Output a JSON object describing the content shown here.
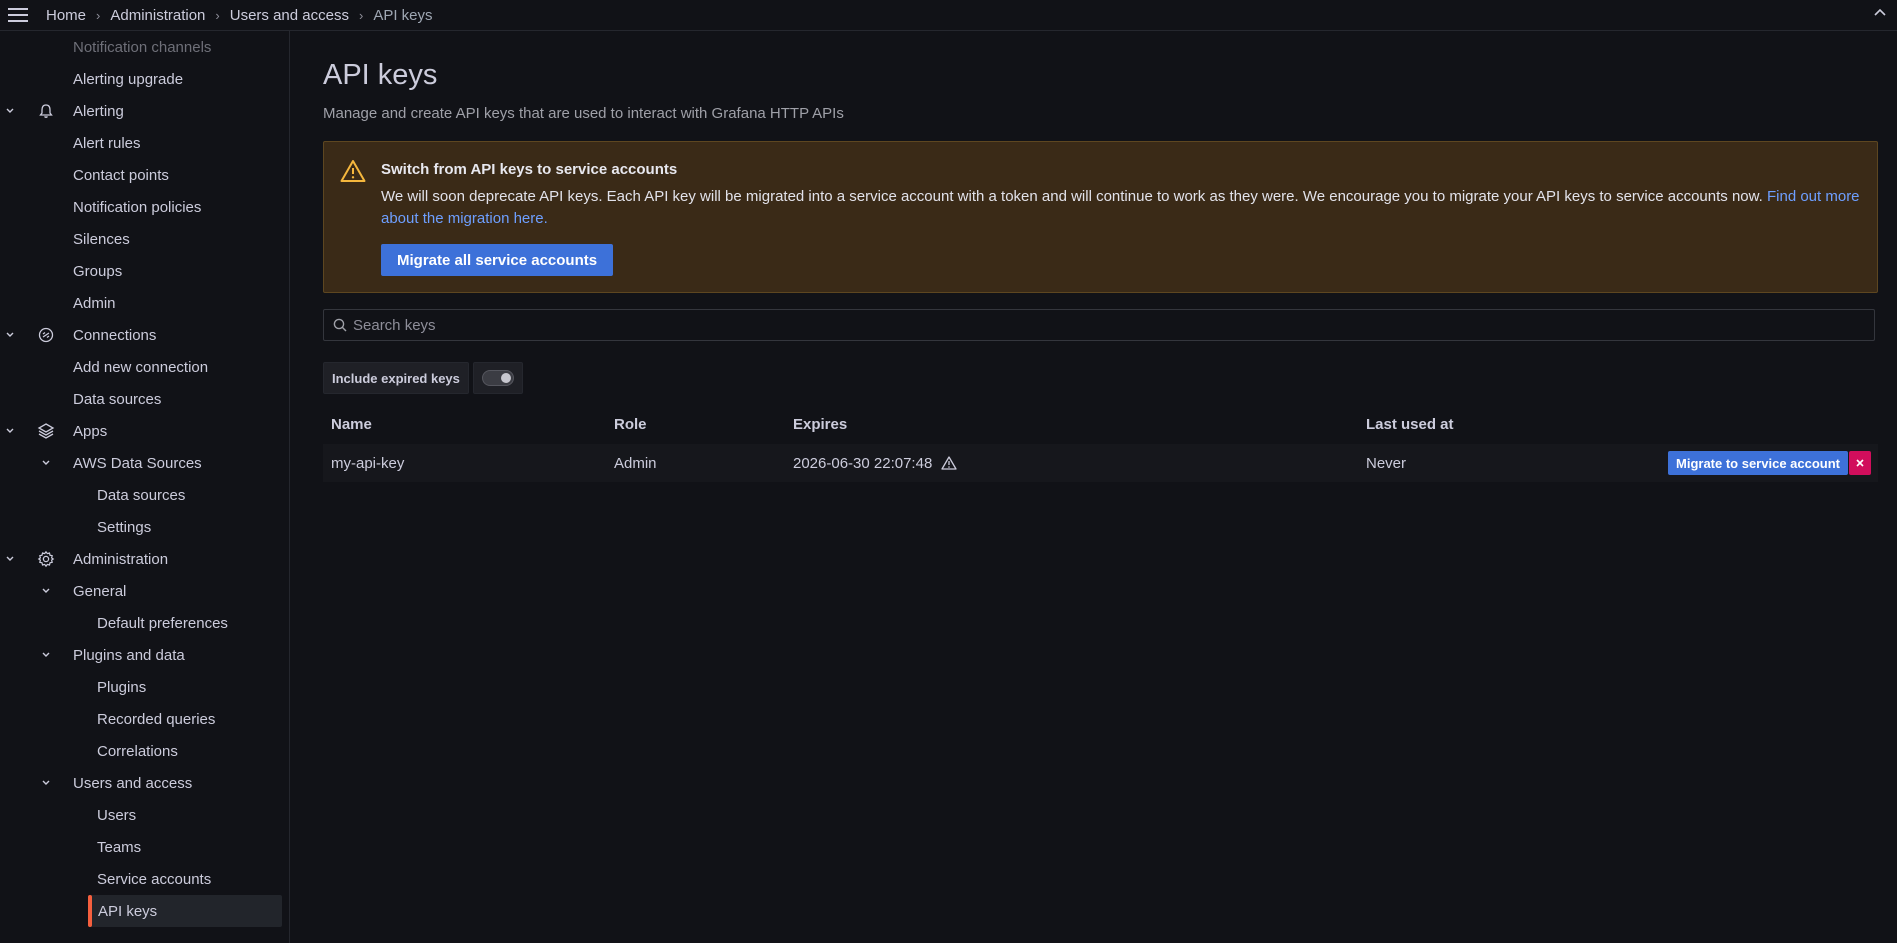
{
  "breadcrumb": {
    "items": [
      "Home",
      "Administration",
      "Users and access",
      "API keys"
    ]
  },
  "sidebar": {
    "items": [
      {
        "label": "Notification channels"
      },
      {
        "label": "Alerting upgrade"
      },
      {
        "label": "Alerting"
      },
      {
        "label": "Alert rules"
      },
      {
        "label": "Contact points"
      },
      {
        "label": "Notification policies"
      },
      {
        "label": "Silences"
      },
      {
        "label": "Groups"
      },
      {
        "label": "Admin"
      },
      {
        "label": "Connections"
      },
      {
        "label": "Add new connection"
      },
      {
        "label": "Data sources"
      },
      {
        "label": "Apps"
      },
      {
        "label": "AWS Data Sources"
      },
      {
        "label": "Data sources"
      },
      {
        "label": "Settings"
      },
      {
        "label": "Administration"
      },
      {
        "label": "General"
      },
      {
        "label": "Default preferences"
      },
      {
        "label": "Plugins and data"
      },
      {
        "label": "Plugins"
      },
      {
        "label": "Recorded queries"
      },
      {
        "label": "Correlations"
      },
      {
        "label": "Users and access"
      },
      {
        "label": "Users"
      },
      {
        "label": "Teams"
      },
      {
        "label": "Service accounts"
      },
      {
        "label": "API keys"
      }
    ]
  },
  "page": {
    "title": "API keys",
    "description": "Manage and create API keys that are used to interact with Grafana HTTP APIs"
  },
  "alert": {
    "title": "Switch from API keys to service accounts",
    "text": "We will soon deprecate API keys. Each API key will be migrated into a service account with a token and will continue to work as they were. We encourage you to migrate your API keys to service accounts now. ",
    "link": "Find out more about the migration here.",
    "button": "Migrate all service accounts"
  },
  "search": {
    "placeholder": "Search keys"
  },
  "filter": {
    "label": "Include expired keys",
    "enabled": false
  },
  "table": {
    "headers": [
      "Name",
      "Role",
      "Expires",
      "Last used at"
    ],
    "rows": [
      {
        "name": "my-api-key",
        "role": "Admin",
        "expires": "2026-06-30 22:07:48",
        "last_used": "Never",
        "migrate_label": "Migrate to service account"
      }
    ]
  },
  "colors": {
    "accent": "#3d71d9",
    "danger": "#d10e5c",
    "warning": "#f5b73d",
    "active_bar": "#f55f3e"
  }
}
